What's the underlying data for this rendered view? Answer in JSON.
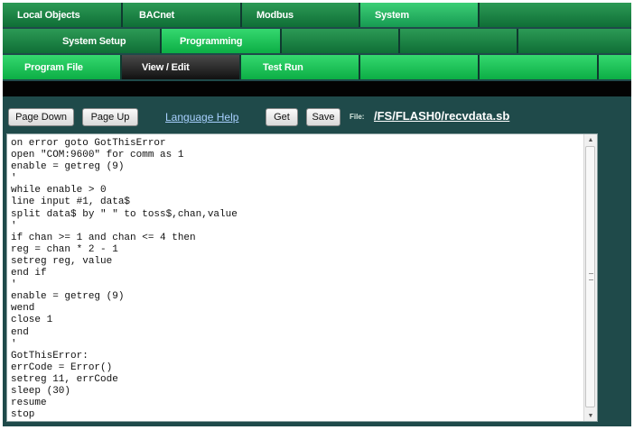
{
  "nav": {
    "row1": [
      "Local Objects",
      "BACnet",
      "Modbus",
      "System",
      ""
    ],
    "row2": [
      "System Setup",
      "Programming",
      "",
      "",
      ""
    ],
    "row3": [
      "Program File",
      "View / Edit",
      "Test Run",
      "",
      "",
      ""
    ]
  },
  "toolbar": {
    "page_down": "Page Down",
    "page_up": "Page Up",
    "language_help": "Language Help",
    "get": "Get",
    "save": "Save",
    "file_label": "File:",
    "file_path": "/FS/FLASH0/recvdata.sb"
  },
  "editor": {
    "code": "on error goto GotThisError\nopen \"COM:9600\" for comm as 1\nenable = getreg (9)\n'\nwhile enable > 0\nline input #1, data$\nsplit data$ by \" \" to toss$,chan,value\n'\nif chan >= 1 and chan <= 4 then\nreg = chan * 2 - 1\nsetreg reg, value\nend if\n'\nenable = getreg (9)\nwend\nclose 1\nend\n'\nGotThisError:\nerrCode = Error()\nsetreg 11, errCode\nsleep (30)\nresume\nstop"
  },
  "colors": {
    "frame": "#1f4a4a",
    "tab_dark": "#157a40",
    "tab_light": "#18c055",
    "link": "#a8d0ff"
  },
  "icons": {
    "scroll_up": "up-arrow-icon",
    "scroll_down": "down-arrow-icon"
  }
}
